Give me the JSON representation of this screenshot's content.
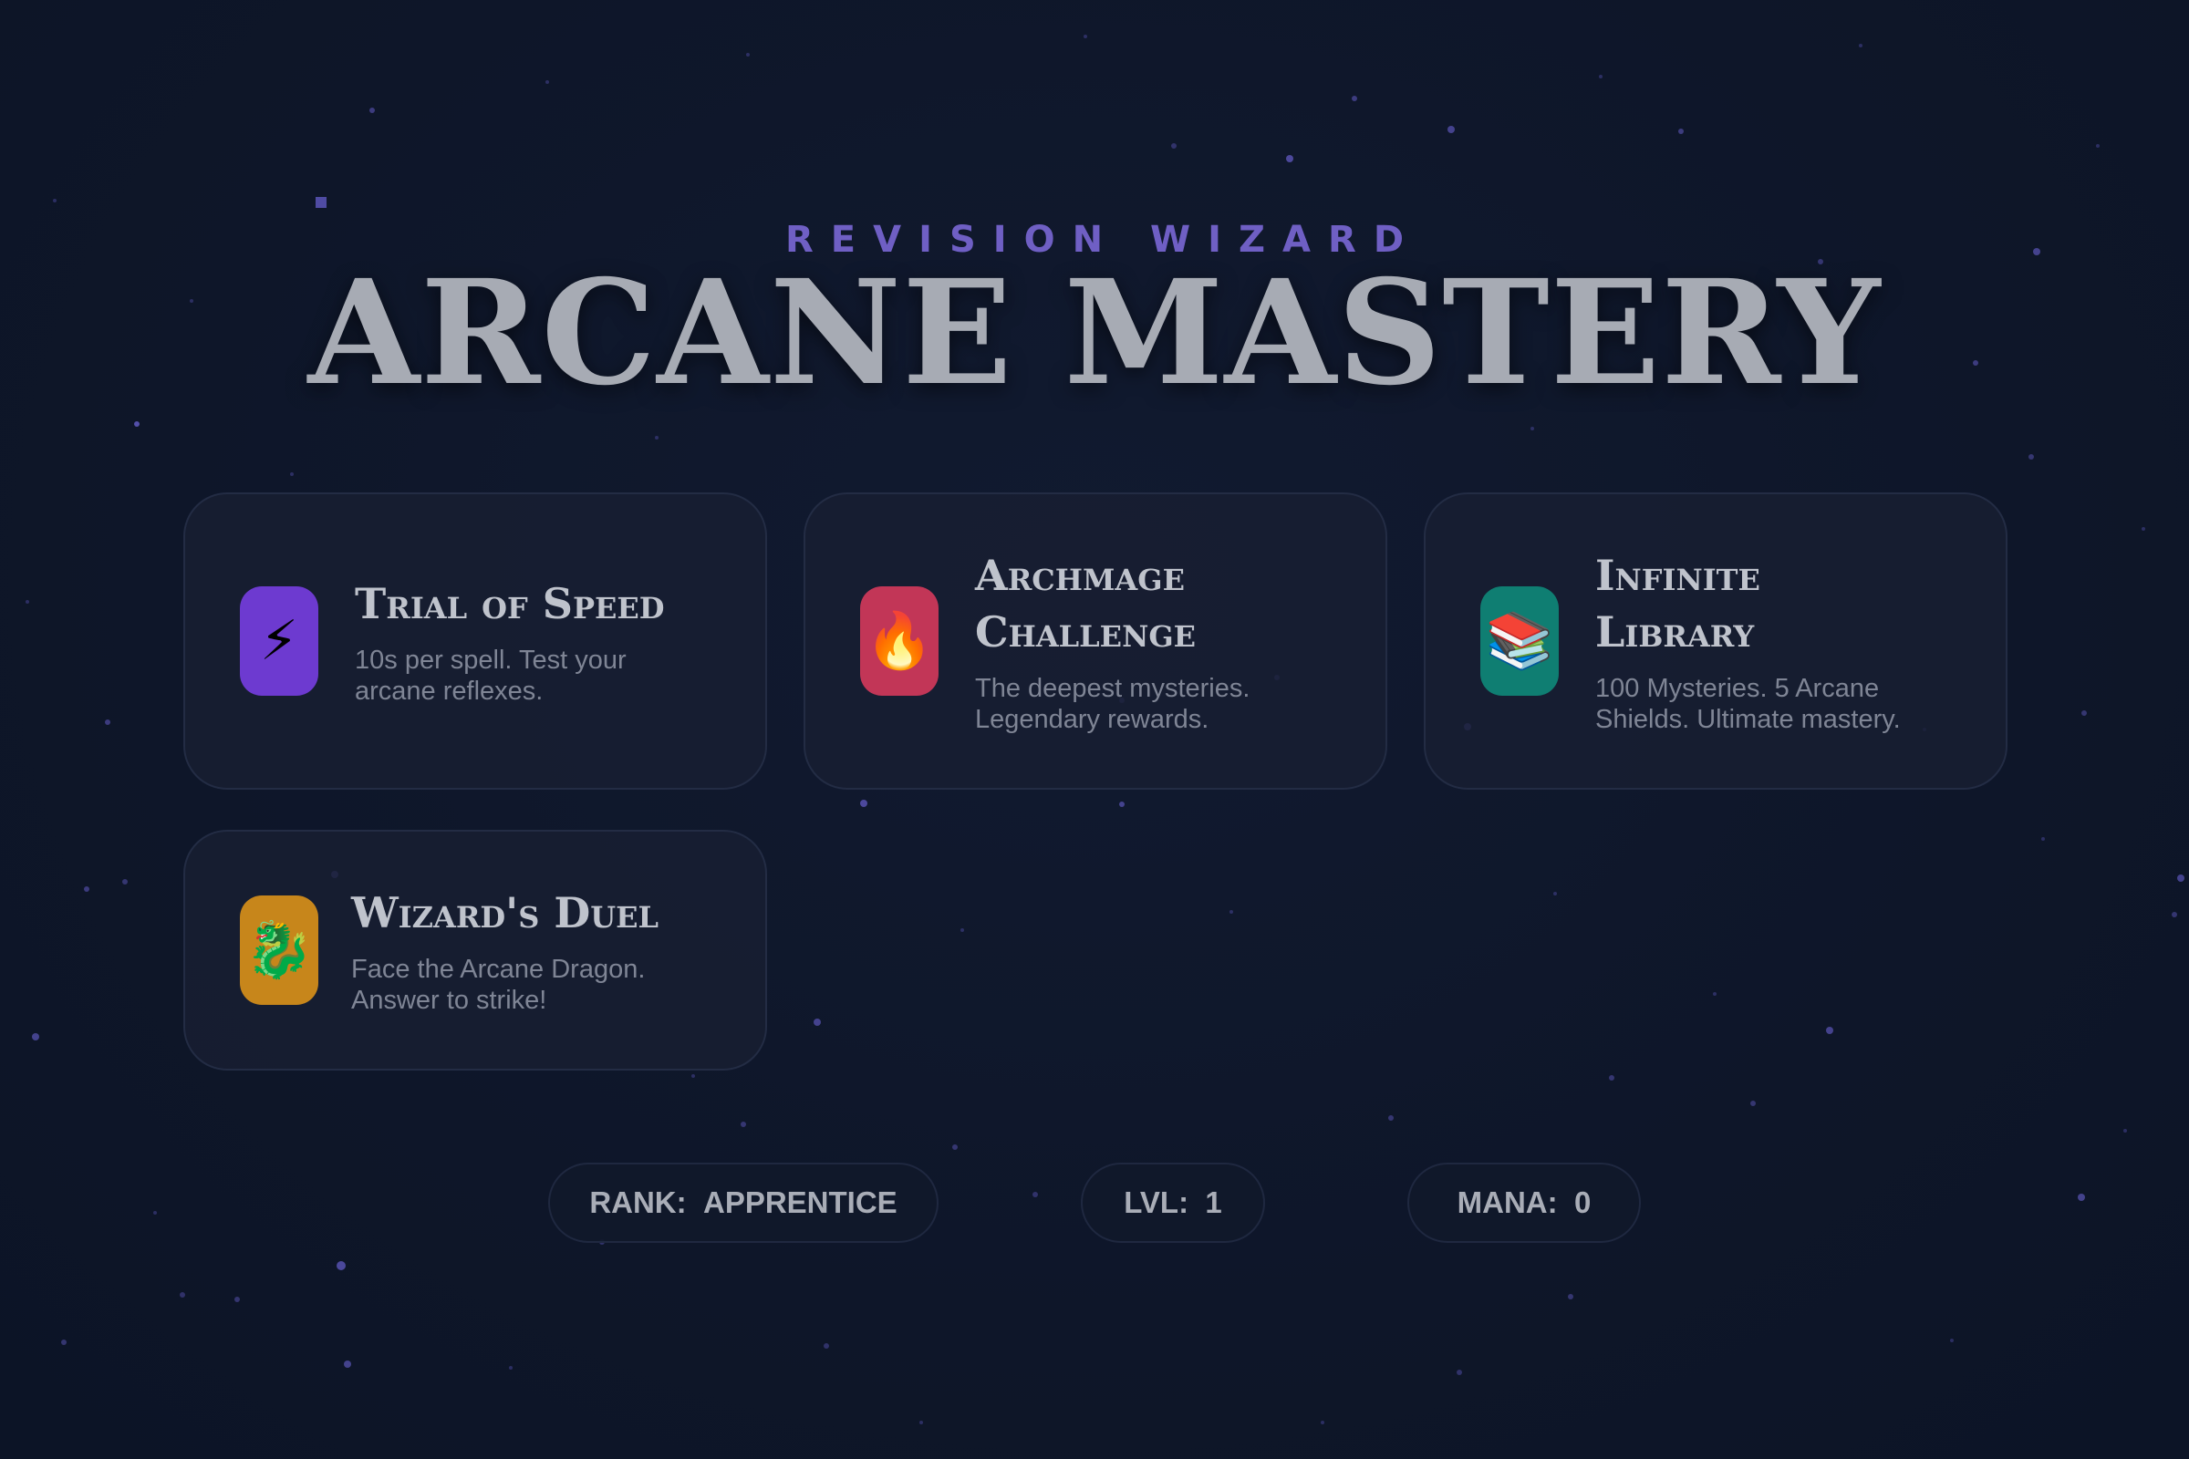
{
  "header": {
    "eyebrow": "REVISION WIZARD",
    "title": "ARCANE MASTERY"
  },
  "modes": [
    {
      "title": "Trial of Speed",
      "description": "10s per spell. Test your arcane reflexes.",
      "icon": "lightning-icon",
      "icon_glyph": "⚡",
      "color": "#6d3ad0"
    },
    {
      "title": "Archmage Challenge",
      "description": "The deepest mysteries. Legendary rewards.",
      "icon": "fire-icon",
      "icon_glyph": "🔥",
      "color": "#c23657"
    },
    {
      "title": "Infinite Library",
      "description": "100 Mysteries. 5 Arcane Shields. Ultimate mastery.",
      "icon": "books-icon",
      "icon_glyph": "📚",
      "color": "#0f7e72"
    },
    {
      "title": "Wizard's Duel",
      "description": "Face the Arcane Dragon. Answer to strike!",
      "icon": "dragon-icon",
      "icon_glyph": "🐉",
      "color": "#c7861b"
    }
  ],
  "stats": {
    "rank": {
      "label": "RANK:",
      "value": "APPRENTICE"
    },
    "level": {
      "label": "LVL:",
      "value": "1"
    },
    "mana": {
      "label": "MANA:",
      "value": "0"
    }
  },
  "colors": {
    "background": "#0e1629",
    "accent": "#6f5fc4",
    "star": "#5b55b8"
  }
}
